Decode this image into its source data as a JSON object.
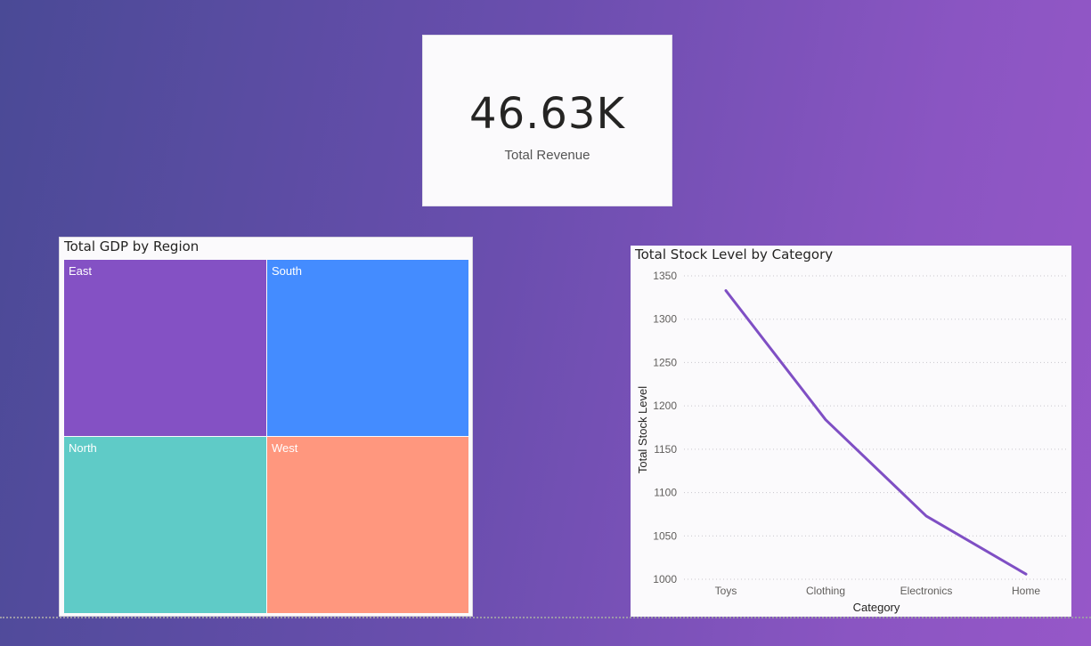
{
  "kpi": {
    "value": "46.63K",
    "label": "Total Revenue"
  },
  "treemap": {
    "title": "Total GDP by Region",
    "tiles": [
      {
        "label": "East",
        "color": "#8451c4"
      },
      {
        "label": "South",
        "color": "#448cff"
      },
      {
        "label": "North",
        "color": "#5fcbc7"
      },
      {
        "label": "West",
        "color": "#ff977e"
      }
    ]
  },
  "chart_data": {
    "type": "line",
    "title": "Total Stock Level by Category",
    "xlabel": "Category",
    "ylabel": "Total Stock Level",
    "categories": [
      "Toys",
      "Clothing",
      "Electronics",
      "Home"
    ],
    "series": [
      {
        "values": [
          1333,
          1184,
          1073,
          1006
        ],
        "color": "#7f4fc4"
      }
    ],
    "yticks": [
      1000,
      1050,
      1100,
      1150,
      1200,
      1250,
      1300,
      1350
    ],
    "ylim": [
      1000,
      1350
    ],
    "grid": true
  },
  "colors": {
    "line": "#7f4fc4",
    "gridline": "#c8c6cc"
  }
}
